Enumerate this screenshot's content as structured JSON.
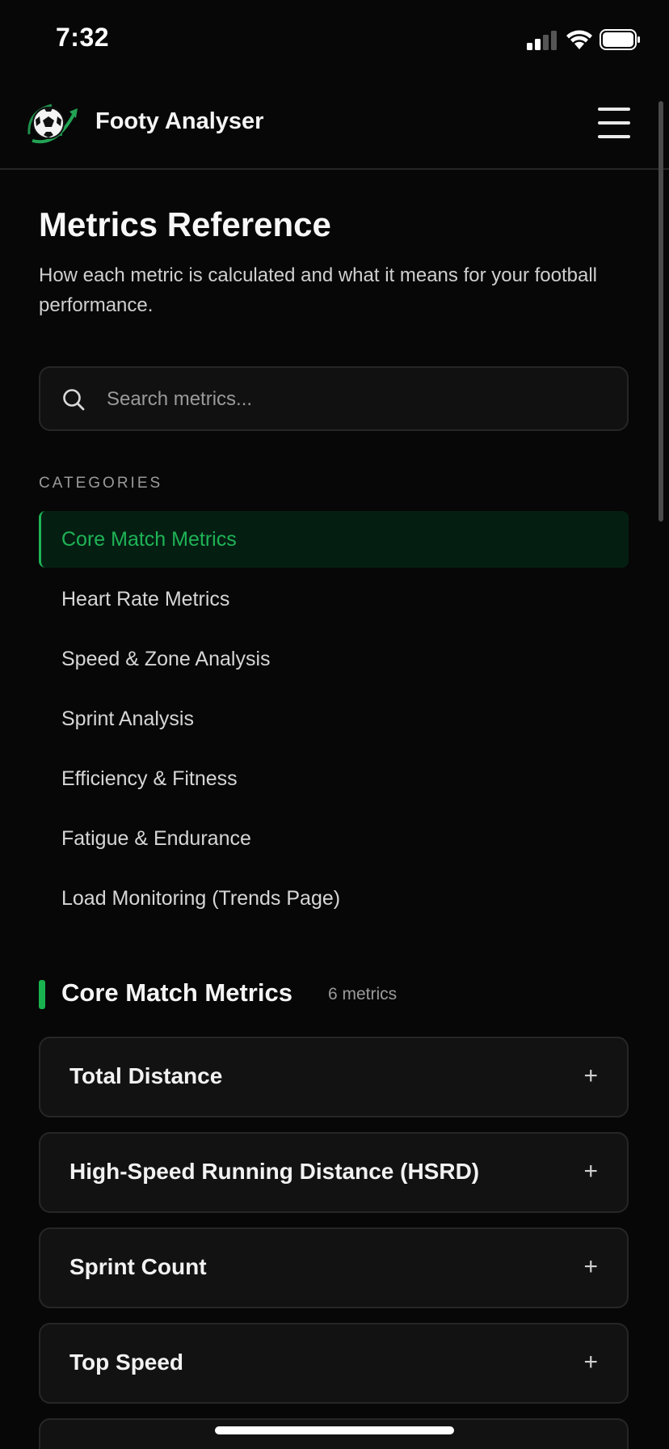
{
  "status_bar": {
    "time": "7:32"
  },
  "header": {
    "app_title": "Footy Analyser",
    "logo_icon": "soccer-ball-logo",
    "menu_icon": "hamburger-menu-icon"
  },
  "page": {
    "title": "Metrics Reference",
    "subtitle": "How each metric is calculated and what it means for your football performance."
  },
  "search": {
    "placeholder": "Search metrics...",
    "value": ""
  },
  "categories": {
    "label": "CATEGORIES",
    "items": [
      {
        "label": "Core Match Metrics",
        "active": true
      },
      {
        "label": "Heart Rate Metrics",
        "active": false
      },
      {
        "label": "Speed & Zone Analysis",
        "active": false
      },
      {
        "label": "Sprint Analysis",
        "active": false
      },
      {
        "label": "Efficiency & Fitness",
        "active": false
      },
      {
        "label": "Fatigue & Endurance",
        "active": false
      },
      {
        "label": "Load Monitoring (Trends Page)",
        "active": false
      }
    ]
  },
  "section": {
    "title": "Core Match Metrics",
    "count": "6 metrics",
    "metrics": [
      {
        "title": "Total Distance",
        "toggle": "+"
      },
      {
        "title": "High-Speed Running Distance (HSRD)",
        "toggle": "+"
      },
      {
        "title": "Sprint Count",
        "toggle": "+"
      },
      {
        "title": "Top Speed",
        "toggle": "+"
      }
    ]
  },
  "colors": {
    "accent": "#1fb356",
    "background": "#070707",
    "card": "#121212",
    "active_bg": "#041f12"
  }
}
